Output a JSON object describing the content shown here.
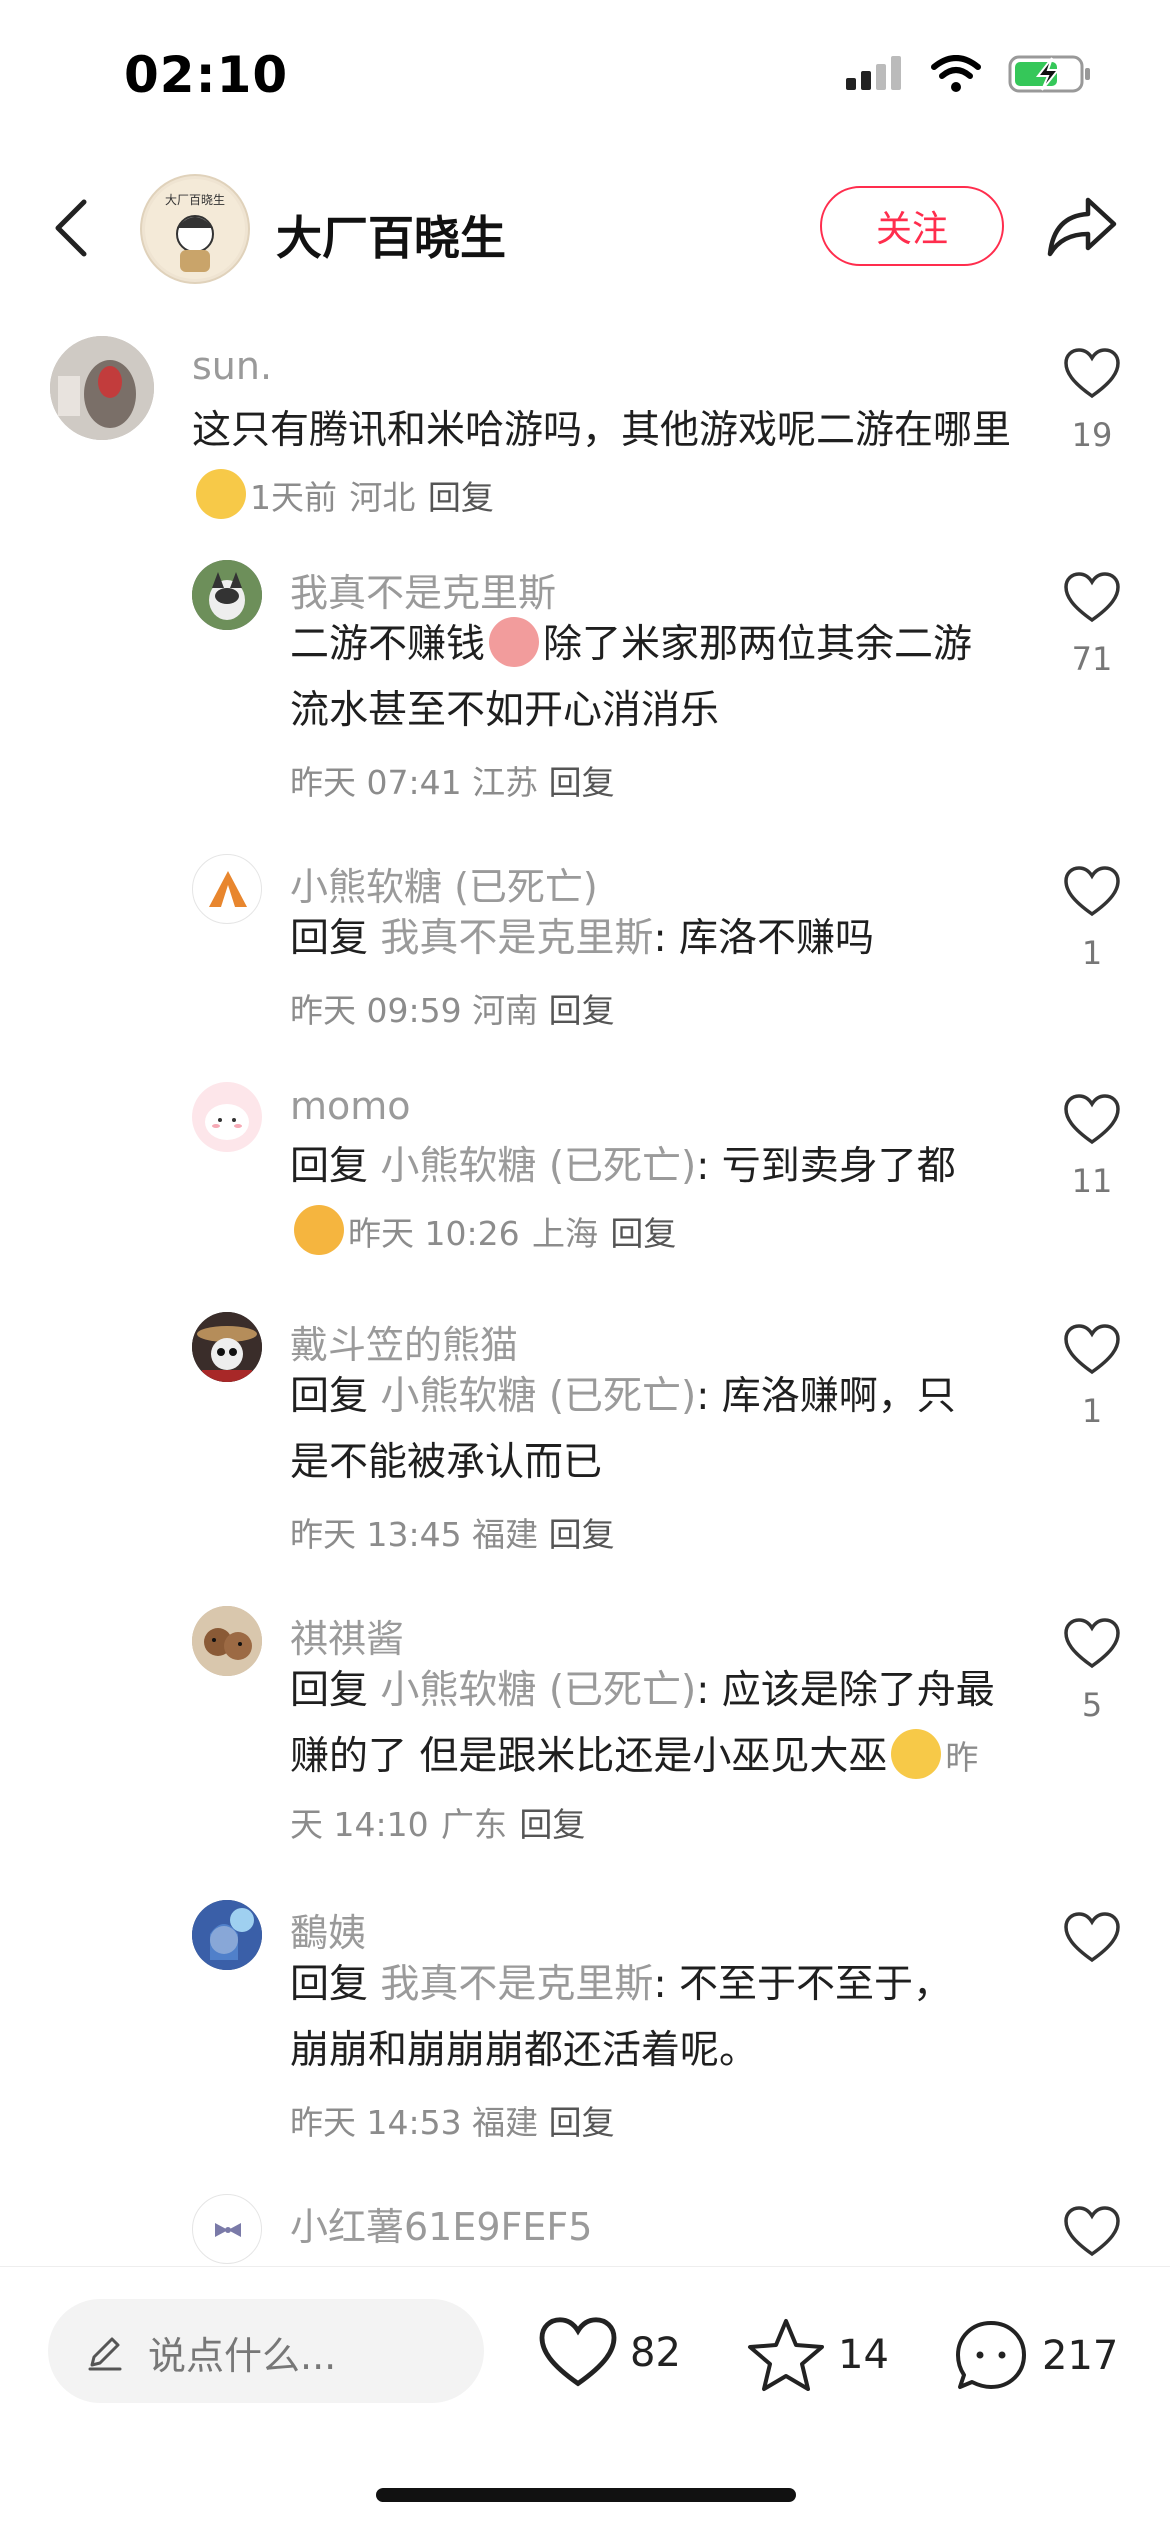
{
  "status": {
    "time": "02:10"
  },
  "header": {
    "title": "大厂百晓生",
    "avatar_text": "大厂百晓生",
    "follow_label": "关注"
  },
  "comments": [
    {
      "user": "sun.",
      "text": "这只有腾讯和米哈游吗，其他游戏呢二游在哪里",
      "time": "1天前",
      "location": "河北",
      "reply_label": "回复",
      "likes": "19"
    },
    {
      "user": "我真不是克里斯",
      "text_a": "二游不赚钱",
      "text_b": "除了米家那两位其余二游流水甚至不如开心消消乐",
      "time": "昨天 07:41",
      "location": "江苏",
      "reply_label": "回复",
      "likes": "71"
    },
    {
      "user": "小熊软糖 (已死亡)",
      "reply_prefix": "回复",
      "reply_to": "我真不是克里斯",
      "text": ": 库洛不赚吗",
      "time": "昨天 09:59",
      "location": "河南",
      "reply_label": "回复",
      "likes": "1"
    },
    {
      "user": "momo",
      "reply_prefix": "回复",
      "reply_to": "小熊软糖 (已死亡)",
      "text": ": 亏到卖身了都",
      "time": "昨天 10:26",
      "location": "上海",
      "reply_label": "回复",
      "likes": "11"
    },
    {
      "user": "戴斗笠的熊猫",
      "reply_prefix": "回复",
      "reply_to": "小熊软糖 (已死亡)",
      "text": ": 库洛赚啊，只是不能被承认而已",
      "time": "昨天 13:45",
      "location": "福建",
      "reply_label": "回复",
      "likes": "1"
    },
    {
      "user": "祺祺酱",
      "reply_prefix": "回复",
      "reply_to": "小熊软糖 (已死亡)",
      "text": ": 应该是除了舟最赚的了 但是跟米比还是小巫见大巫",
      "time": "昨天 14:10",
      "location": "广东",
      "reply_label": "回复",
      "likes": "5"
    },
    {
      "user": "鷭姨",
      "reply_prefix": "回复",
      "reply_to": "我真不是克里斯",
      "text": ": 不至于不至于，崩崩和崩崩崩都还活着呢。",
      "time": "昨天 14:53",
      "location": "福建",
      "reply_label": "回复",
      "likes": ""
    },
    {
      "user": "小红薯61E9FEF5",
      "likes": ""
    }
  ],
  "bottom": {
    "input_placeholder": "说点什么...",
    "likes": "82",
    "stars": "14",
    "comments": "217"
  },
  "colors": {
    "accent": "#ff2d4d",
    "muted": "#9a9a9a"
  }
}
